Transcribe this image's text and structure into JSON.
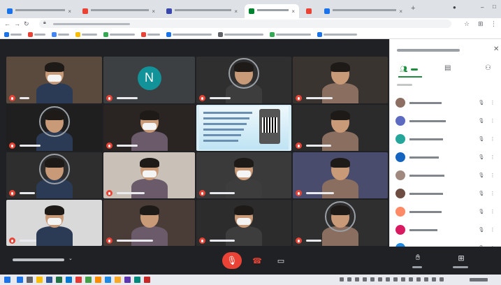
{
  "browser": {
    "tabs": [
      {
        "title": "",
        "favicon_color": "#1a73e8"
      },
      {
        "title": "",
        "favicon_color": "#ea4335"
      },
      {
        "title": "",
        "favicon_color": "#3949ab"
      },
      {
        "title": "",
        "favicon_color": "#00832d",
        "active": true
      },
      {
        "title": "",
        "favicon_color": "#ea4335"
      },
      {
        "title": "",
        "favicon_color": "#1a73e8"
      }
    ],
    "url": "",
    "bookmarks": [
      {
        "label": "",
        "color": "#1a73e8"
      },
      {
        "label": "",
        "color": "#ea4335"
      },
      {
        "label": "",
        "color": "#4285f4"
      },
      {
        "label": "",
        "color": "#fbbc04"
      },
      {
        "label": "",
        "color": "#34a853"
      },
      {
        "label": "",
        "color": "#ea4335"
      },
      {
        "label": "",
        "color": "#1a73e8"
      },
      {
        "label": "",
        "color": "#5f6368"
      },
      {
        "label": "",
        "color": "#34a853"
      },
      {
        "label": "",
        "color": "#1a73e8"
      }
    ]
  },
  "meeting": {
    "participants": [
      {
        "name": "",
        "kind": "video"
      },
      {
        "name": "",
        "kind": "avatar",
        "initial": "N"
      },
      {
        "name": "",
        "kind": "photo"
      },
      {
        "name": "",
        "kind": "video"
      },
      {
        "name": "",
        "kind": "photo"
      },
      {
        "name": "",
        "kind": "video"
      },
      {
        "name": "",
        "kind": "presentation"
      },
      {
        "name": "",
        "kind": "video"
      },
      {
        "name": "",
        "kind": "photo"
      },
      {
        "name": "",
        "kind": "video"
      },
      {
        "name": "",
        "kind": "video"
      },
      {
        "name": "",
        "kind": "video"
      },
      {
        "name": "",
        "kind": "video"
      },
      {
        "name": "",
        "kind": "video"
      },
      {
        "name": "",
        "kind": "video"
      },
      {
        "name": "",
        "kind": "photo"
      }
    ],
    "meeting_title": ""
  },
  "panel": {
    "title": "",
    "tab_people_count": "",
    "subheading": "",
    "people": [
      {
        "name": "",
        "avatar_color": "#8d6e63"
      },
      {
        "name": "",
        "avatar_color": "#5c6bc0"
      },
      {
        "name": "",
        "avatar_color": "#26a69a"
      },
      {
        "name": "",
        "avatar_color": "#1565c0"
      },
      {
        "name": "",
        "avatar_color": "#a1887f"
      },
      {
        "name": "",
        "avatar_color": "#6d4c41"
      },
      {
        "name": "",
        "avatar_color": "#ff8a65"
      },
      {
        "name": "",
        "avatar_color": "#d81b60"
      },
      {
        "name": "",
        "avatar_color": "#1e88e5"
      },
      {
        "name": "",
        "avatar_color": "#e53935"
      }
    ]
  },
  "controls": {
    "raise_hand_label": "",
    "activities_label": ""
  },
  "colors": {
    "meet_background": "#202124",
    "leave_button": "#ea4335",
    "mic_off_badge": "#ea4335",
    "panel_accent": "#1e8e3e"
  }
}
